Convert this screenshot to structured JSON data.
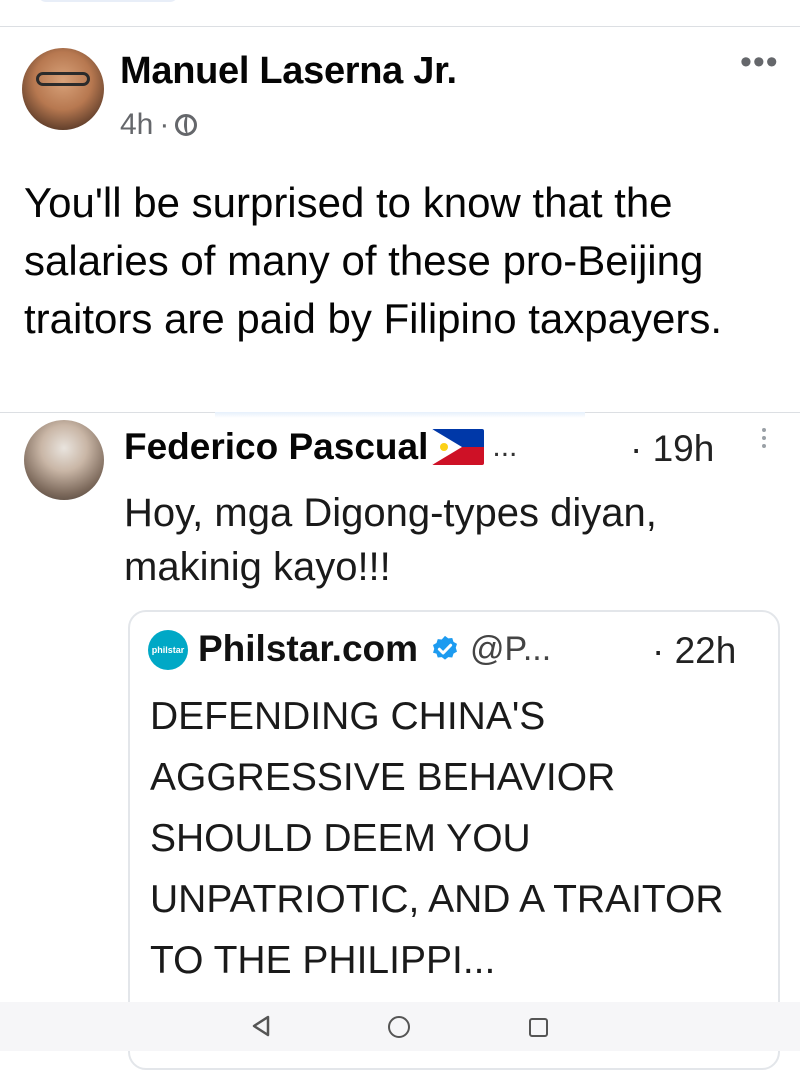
{
  "post": {
    "author": "Manuel Laserna Jr.",
    "time": "4h",
    "separator": "·",
    "text": "You'll be surprised to know that the salaries of many of these pro-Beijing traitors are paid by Filipino taxpayers.",
    "more_label": "•••"
  },
  "shared_tweet": {
    "author": "Federico Pascual",
    "ellipsis": "...",
    "time": "· 19h",
    "text": "Hoy, mga Digong-types diyan, makinig kayo!!!",
    "quoted": {
      "logo_text": "philstar",
      "author": "Philstar.com",
      "handle": "@P...",
      "time": "· 22h",
      "text": "DEFENDING CHINA'S AGGRESSIVE BEHAVIOR SHOULD DEEM YOU UNPATRIOTIC, AND A TRAITOR TO THE PHILIPPI..."
    }
  },
  "colors": {
    "accent_verified": "#1d9bf0",
    "meta_gray": "#65676b"
  },
  "icons": [
    "globe-icon",
    "more-icon",
    "philippine-flag-icon",
    "verified-badge-icon",
    "nav-back-icon",
    "nav-home-icon",
    "nav-recents-icon"
  ]
}
